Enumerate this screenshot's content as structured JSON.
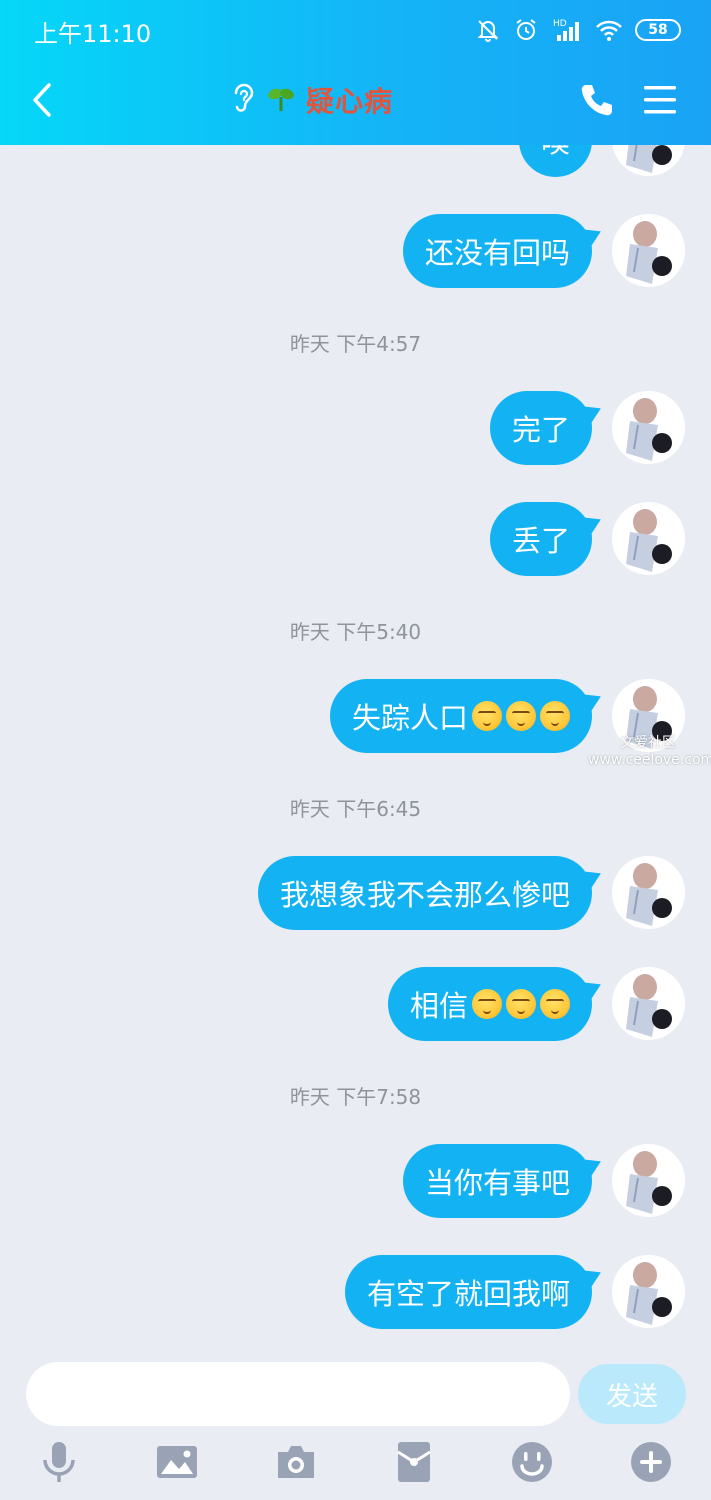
{
  "status_bar": {
    "time": "上午11:10",
    "battery": "58",
    "network": "HD"
  },
  "header": {
    "title": "疑心病"
  },
  "messages": [
    {
      "text": "嗅"
    },
    {
      "text": "还没有回吗"
    },
    {
      "text": "完了"
    },
    {
      "text": "丢了"
    },
    {
      "text": "失踪人口"
    },
    {
      "text": "我想象我不会那么惨吧"
    },
    {
      "text": "相信"
    },
    {
      "text": "当你有事吧"
    },
    {
      "text": "有空了就回我啊"
    }
  ],
  "timestamps": [
    "昨天 下午4:57",
    "昨天 下午5:40",
    "昨天 下午6:45",
    "昨天 下午7:58"
  ],
  "watermark": {
    "line1": "文爱社区",
    "line2": "www.ceelove.com"
  },
  "input": {
    "value": "",
    "send_label": "发送"
  },
  "toolbar": [
    "microphone-icon",
    "image-icon",
    "camera-icon",
    "red-packet-icon",
    "emoji-icon",
    "plus-icon"
  ],
  "colors": {
    "bubble": "#13b3f3",
    "header_start": "#05d7f8",
    "header_end": "#1aa3f5",
    "title": "#e0553e",
    "background": "#e9ecf3"
  }
}
